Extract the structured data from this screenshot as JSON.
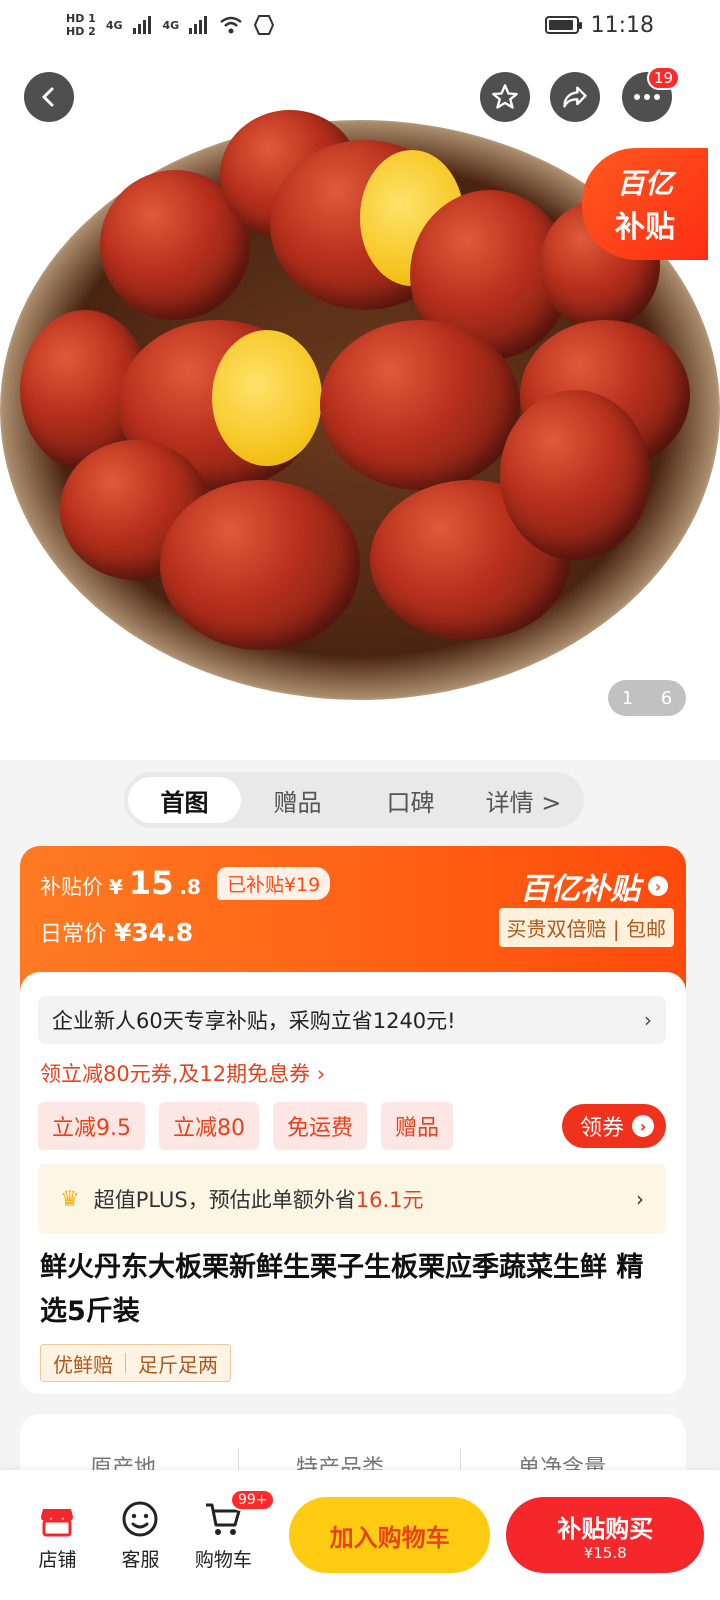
{
  "status_bar": {
    "sim1": "HD 1",
    "sim2": "HD 2",
    "signal1": "4G",
    "signal2": "4G",
    "time": "11:18"
  },
  "header": {
    "more_badge": "19",
    "icons": [
      "back-icon",
      "star-icon",
      "share-icon",
      "more-icon"
    ]
  },
  "hero": {
    "subsidy_corner_line1": "百亿",
    "subsidy_corner_line2": "补贴",
    "pager_current": "1",
    "pager_total": "6"
  },
  "tabs": [
    {
      "label": "首图",
      "active": true
    },
    {
      "label": "赠品",
      "active": false
    },
    {
      "label": "口碑",
      "active": false
    },
    {
      "label": "详情 >",
      "active": false
    }
  ],
  "price": {
    "subsidy_label": "补贴价",
    "yen": "¥",
    "subsidy_price_int": "15",
    "subsidy_price_dec": ".8",
    "subsidized_pill": "已补贴¥19",
    "normal_label": "日常价",
    "normal_price": "¥34.8",
    "brand": "百亿补贴",
    "tagline": "买贵双倍赔 | 包邮"
  },
  "promo": {
    "enterprise_text": "企业新人60天专享补贴，采购立省1240元!",
    "coupon_line": "领立减80元券,及12期免息券 ›",
    "chips": [
      "立减9.5",
      "立减80",
      "免运费",
      "赠品"
    ],
    "get_coupon": "领券",
    "plus_prefix": "超值PLUS，预估此单额外省",
    "plus_amount": "16.1元"
  },
  "product": {
    "title": "鲜火丹东大板栗新鲜生栗子生板栗应季蔬菜生鲜 精选5斤装",
    "tags": [
      "优鲜赔",
      "足斤足两"
    ]
  },
  "specs": [
    "原产地",
    "特产品类",
    "单净含量"
  ],
  "bottom_bar": {
    "store": "店铺",
    "service": "客服",
    "cart": "购物车",
    "cart_badge": "99+",
    "add_to_cart": "加入购物车",
    "buy": "补贴购买",
    "buy_price": "¥15.8"
  },
  "colors": {
    "accent_orange": "#ff5a10",
    "accent_red": "#f5272a",
    "cart_yellow": "#ffcc12"
  }
}
